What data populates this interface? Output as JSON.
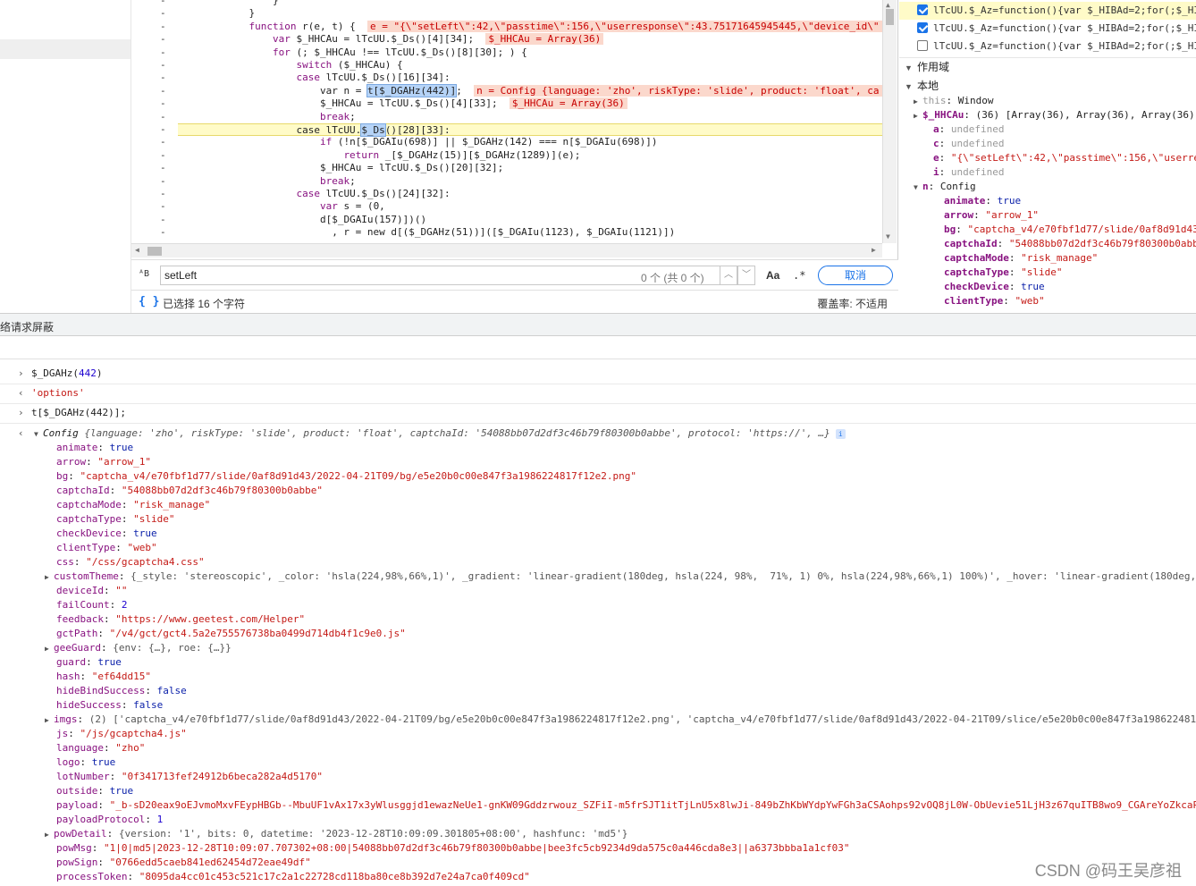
{
  "editor": {
    "gutter": [
      "-",
      "-",
      "-",
      "-",
      "-",
      "-",
      "-",
      "-",
      "-",
      "-",
      "-",
      "-",
      "-",
      "-",
      "-",
      "-",
      "-",
      "-"
    ],
    "code_lines": [
      {
        "indent": "                ",
        "text": "}"
      },
      {
        "indent": "            ",
        "text": "}"
      },
      {
        "indent": "            ",
        "text": "function r(e, t) {",
        "inline": "e = \"{\\\"setLeft\\\":42,\\\"passtime\\\":156,\\\"userresponse\\\":43.75171645945445,\\\"device_id\\\""
      },
      {
        "indent": "                ",
        "text": "var $_HHCAu = lTcUU.$_Ds()[4][34];",
        "inline": "$_HHCAu = Array(36)"
      },
      {
        "indent": "                ",
        "text": "for (; $_HHCAu !== lTcUU.$_Ds()[8][30]; ) {"
      },
      {
        "indent": "                    ",
        "text": "switch ($_HHCAu) {"
      },
      {
        "indent": "                    ",
        "text": "case lTcUU.$_Ds()[16][34]:"
      },
      {
        "indent": "                        ",
        "text": "var n = t[$_DGAHz(442)];",
        "inline": "n = Config {language: 'zho', riskType: 'slide', product: 'float', ca"
      },
      {
        "indent": "                        ",
        "text": "$_HHCAu = lTcUU.$_Ds()[4][33];",
        "inline": "$_HHCAu = Array(36)"
      },
      {
        "indent": "                        ",
        "text": "break;"
      },
      {
        "indent": "                    ",
        "text": "case lTcUU.$_Ds()[28][33]:"
      },
      {
        "indent": "                        ",
        "text": "if (!n[$_DGAIu(698)] || $_DGAHz(142) === n[$_DGAIu(698)])"
      },
      {
        "indent": "                            ",
        "text": "return _[$_DGAHz(15)][$_DGAHz(1289)](e);"
      },
      {
        "indent": "                        ",
        "text": "$_HHCAu = lTcUU.$_Ds()[20][32];"
      },
      {
        "indent": "                        ",
        "text": "break;"
      },
      {
        "indent": "                    ",
        "text": "case lTcUU.$_Ds()[24][32]:"
      },
      {
        "indent": "                        ",
        "text": "var s = (0,"
      },
      {
        "indent": "                        ",
        "text": "d[$_DGAIu(157)])()"
      },
      {
        "indent": "                          ",
        "text": ", r = new d[($_DGAHz(51))]([$_DGAIu(1123), $_DGAIu(1121)])"
      }
    ]
  },
  "search": {
    "value": "setLeft",
    "match_count": "0 个 (共 0 个)",
    "case_label": "Aa",
    "regex_label": ".*",
    "cancel_label": "取消",
    "up_arrow": "︿",
    "down_arrow": "﹀",
    "case_icon": "ᴬB"
  },
  "status": {
    "braces": "{ }",
    "selection": "已选择 16 个字符",
    "coverage": "覆盖率:  不适用"
  },
  "breakpoints": [
    {
      "checked": true,
      "active": true,
      "text": "lTcUU.$_Az=function(){var $_HIBAd=2;for(;$_HI"
    },
    {
      "checked": true,
      "active": false,
      "text": "lTcUU.$_Az=function(){var $_HIBAd=2;for(;$_HI"
    },
    {
      "checked": false,
      "active": false,
      "text": "lTcUU.$_Az=function(){var $_HIBAd=2;for(;$_HI"
    }
  ],
  "scope": {
    "scope_label": "作用域",
    "local_label": "本地",
    "tri_open": "▼",
    "tri_closed": "▶",
    "entries": [
      {
        "key": "this",
        "value": "Window",
        "kind": "plain",
        "expand": "closed",
        "indent": 1
      },
      {
        "key": "$_HHCAu",
        "value": "(36) [Array(36), Array(36), Array(36)",
        "kind": "plain",
        "expand": "closed",
        "indent": 1,
        "bold": true
      },
      {
        "key": "a",
        "value": "undefined",
        "kind": "grey",
        "indent": 2
      },
      {
        "key": "c",
        "value": "undefined",
        "kind": "grey",
        "indent": 2
      },
      {
        "key": "e",
        "value": "\"{\\\"setLeft\\\":42,\\\"passtime\\\":156,\\\"userres",
        "kind": "str",
        "indent": 2
      },
      {
        "key": "i",
        "value": "undefined",
        "kind": "grey",
        "indent": 2
      },
      {
        "key": "n",
        "value": "Config",
        "kind": "plain",
        "expand": "open",
        "indent": 1
      },
      {
        "key": "animate",
        "value": "true",
        "kind": "kw",
        "indent": 3
      },
      {
        "key": "arrow",
        "value": "\"arrow_1\"",
        "kind": "str",
        "indent": 3
      },
      {
        "key": "bg",
        "value": "\"captcha_v4/e70fbf1d77/slide/0af8d91d43/2",
        "kind": "str",
        "indent": 3
      },
      {
        "key": "captchaId",
        "value": "\"54088bb07d2df3c46b79f80300b0abbe",
        "kind": "str",
        "indent": 3
      },
      {
        "key": "captchaMode",
        "value": "\"risk_manage\"",
        "kind": "str",
        "indent": 3
      },
      {
        "key": "captchaType",
        "value": "\"slide\"",
        "kind": "str",
        "indent": 3
      },
      {
        "key": "checkDevice",
        "value": "true",
        "kind": "kw",
        "indent": 3
      },
      {
        "key": "clientType",
        "value": "\"web\"",
        "kind": "str",
        "indent": 3
      }
    ]
  },
  "drawer": {
    "label": "络请求屏蔽"
  },
  "console": {
    "glyph_in": "›",
    "glyph_out": "‹",
    "rows": [
      {
        "dir": "in",
        "text": "$_DGAHz(442)",
        "num": "442"
      },
      {
        "dir": "out",
        "text": "'options'",
        "kind": "str"
      },
      {
        "dir": "in",
        "text": "t[$_DGAHz(442)];"
      }
    ],
    "config_summary_prefix": "Config ",
    "config_summary": "{language: 'zho', riskType: 'slide', product: 'float', captchaId: '54088bb07d2df3c46b79f80300b0abbe', protocol: 'https://', …}",
    "info_badge": "i",
    "props": [
      {
        "k": "animate",
        "v": "true",
        "t": "kw"
      },
      {
        "k": "arrow",
        "v": "\"arrow_1\"",
        "t": "str"
      },
      {
        "k": "bg",
        "v": "\"captcha_v4/e70fbf1d77/slide/0af8d91d43/2022-04-21T09/bg/e5e20b0c00e847f3a1986224817f12e2.png\"",
        "t": "str"
      },
      {
        "k": "captchaId",
        "v": "\"54088bb07d2df3c46b79f80300b0abbe\"",
        "t": "str"
      },
      {
        "k": "captchaMode",
        "v": "\"risk_manage\"",
        "t": "str"
      },
      {
        "k": "captchaType",
        "v": "\"slide\"",
        "t": "str"
      },
      {
        "k": "checkDevice",
        "v": "true",
        "t": "kw"
      },
      {
        "k": "clientType",
        "v": "\"web\"",
        "t": "str"
      },
      {
        "k": "css",
        "v": "\"/css/gcaptcha4.css\"",
        "t": "str"
      },
      {
        "k": "customTheme",
        "v": "{_style: 'stereoscopic', _color: 'hsla(224,98%,66%,1)', _gradient: 'linear-gradient(180deg, hsla(224, 98%,  71%, 1) 0%, hsla(224,98%,66%,1) 100%)', _hover: 'linear-gradient(180deg, h",
        "t": "obj",
        "exp": true
      },
      {
        "k": "deviceId",
        "v": "\"\"",
        "t": "str"
      },
      {
        "k": "failCount",
        "v": "2",
        "t": "num"
      },
      {
        "k": "feedback",
        "v": "\"https://www.geetest.com/Helper\"",
        "t": "str"
      },
      {
        "k": "gctPath",
        "v": "\"/v4/gct/gct4.5a2e755576738ba0499d714db4f1c9e0.js\"",
        "t": "str"
      },
      {
        "k": "geeGuard",
        "v": "{env: {…}, roe: {…}}",
        "t": "obj",
        "exp": true
      },
      {
        "k": "guard",
        "v": "true",
        "t": "kw"
      },
      {
        "k": "hash",
        "v": "\"ef64dd15\"",
        "t": "str"
      },
      {
        "k": "hideBindSuccess",
        "v": "false",
        "t": "kw"
      },
      {
        "k": "hideSuccess",
        "v": "false",
        "t": "kw"
      },
      {
        "k": "imgs",
        "v": "(2) ['captcha_v4/e70fbf1d77/slide/0af8d91d43/2022-04-21T09/bg/e5e20b0c00e847f3a1986224817f12e2.png', 'captcha_v4/e70fbf1d77/slide/0af8d91d43/2022-04-21T09/slice/e5e20b0c00e847f3a19862248178",
        "t": "obj",
        "exp": true
      },
      {
        "k": "js",
        "v": "\"/js/gcaptcha4.js\"",
        "t": "str"
      },
      {
        "k": "language",
        "v": "\"zho\"",
        "t": "str"
      },
      {
        "k": "logo",
        "v": "true",
        "t": "kw"
      },
      {
        "k": "lotNumber",
        "v": "\"0f341713fef24912b6beca282a4d5170\"",
        "t": "str"
      },
      {
        "k": "outside",
        "v": "true",
        "t": "kw"
      },
      {
        "k": "payload",
        "v": "\"_b-sD20eax9oEJvmoMxvFEypHBGb--MbuUF1vAx17x3yWlusggjd1ewazNeUe1-gnKW09Gddzrwouz_SZFiI-m5frSJT1itTjLnU5x8lwJi-849bZhKbWYdpYwFGh3aCSAohps92vOQ8jL0W-ObUevie51LjH3z67quITB8wo9_CGAreYoZkcaPi",
        "t": "str"
      },
      {
        "k": "payloadProtocol",
        "v": "1",
        "t": "num"
      },
      {
        "k": "powDetail",
        "v": "{version: '1', bits: 0, datetime: '2023-12-28T10:09:09.301805+08:00', hashfunc: 'md5'}",
        "t": "obj",
        "exp": true
      },
      {
        "k": "powMsg",
        "v": "\"1|0|md5|2023-12-28T10:09:07.707302+08:00|54088bb07d2df3c46b79f80300b0abbe|bee3fc5cb9234d9da575c0a446cda8e3||a6373bbba1a1cf03\"",
        "t": "str"
      },
      {
        "k": "powSign",
        "v": "\"0766edd5caeb841ed62454d72eae49df\"",
        "t": "str"
      },
      {
        "k": "processToken",
        "v": "\"8095da4cc01c453c521c17c2a1c22728cd118ba80ce8b392d7e24a7ca0f409cd\"",
        "t": "str"
      }
    ]
  },
  "watermark": "CSDN @码王吴彦祖",
  "colors": {
    "accent": "#1a73e8",
    "keyword": "#881280",
    "string": "#c41a16",
    "highlight": "#fffbc8"
  }
}
